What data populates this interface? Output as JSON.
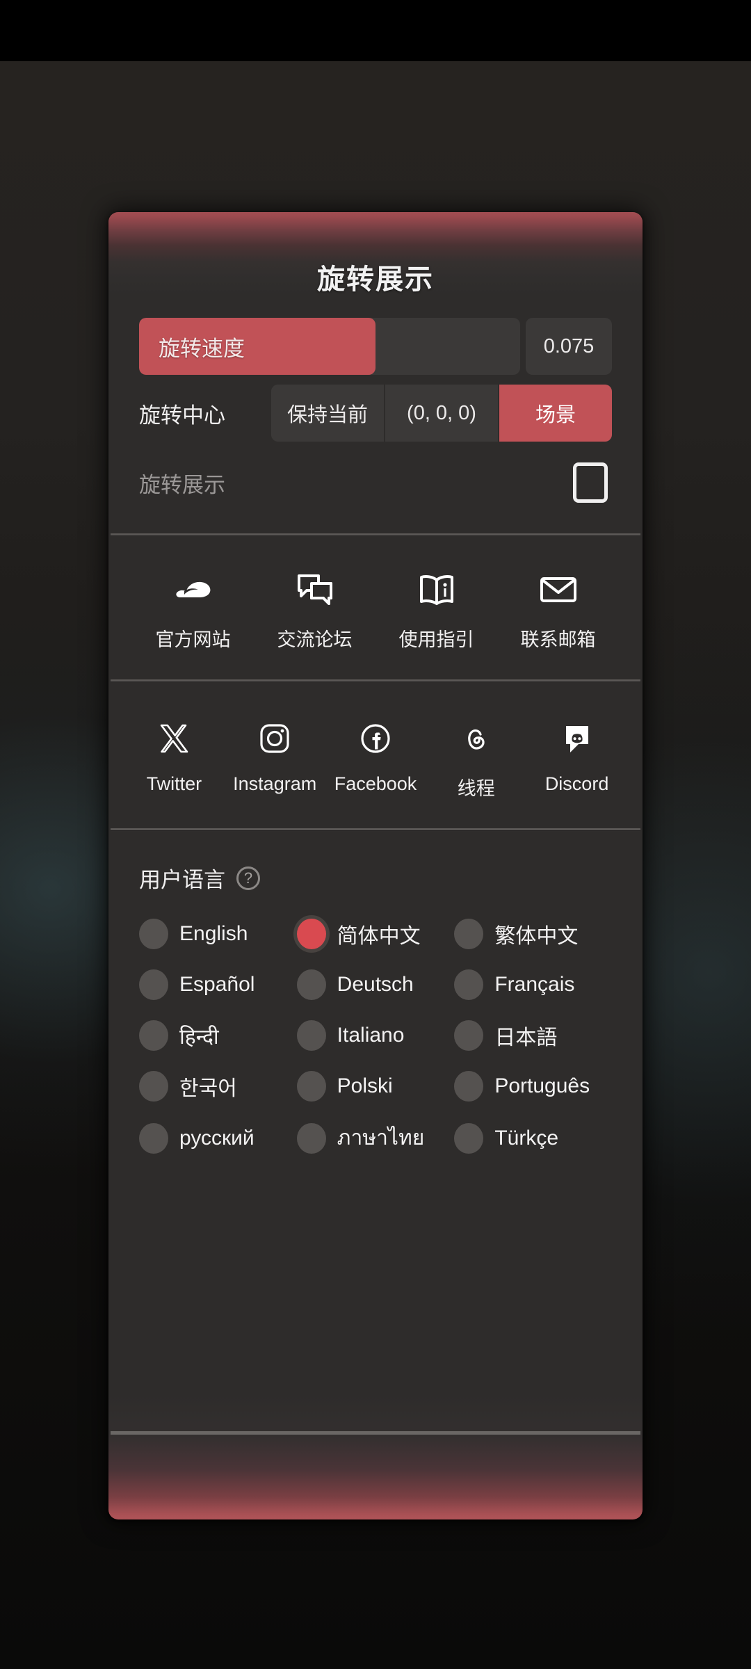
{
  "panel": {
    "title": "旋转展示"
  },
  "rotation": {
    "speed": {
      "label": "旋转速度",
      "value": "0.075",
      "fill_percent": 62
    },
    "center": {
      "label": "旋转中心",
      "options": [
        {
          "label": "保持当前",
          "active": false
        },
        {
          "label": "(0, 0, 0)",
          "active": false
        },
        {
          "label": "场景",
          "active": true
        }
      ]
    },
    "showcase": {
      "label": "旋转展示",
      "checked": false
    }
  },
  "links": [
    {
      "label": "官方网站",
      "icon": "cloud-icon"
    },
    {
      "label": "交流论坛",
      "icon": "forum-icon"
    },
    {
      "label": "使用指引",
      "icon": "book-info-icon"
    },
    {
      "label": "联系邮箱",
      "icon": "envelope-icon"
    }
  ],
  "socials": [
    {
      "label": "Twitter",
      "icon": "twitter-x-icon"
    },
    {
      "label": "Instagram",
      "icon": "instagram-icon"
    },
    {
      "label": "Facebook",
      "icon": "facebook-icon"
    },
    {
      "label": "线程",
      "icon": "threads-icon"
    },
    {
      "label": "Discord",
      "icon": "discord-icon"
    }
  ],
  "language": {
    "title": "用户语言",
    "help": "?",
    "rows": [
      [
        {
          "label": "English",
          "selected": false
        },
        {
          "label": "简体中文",
          "selected": true
        },
        {
          "label": "繁体中文",
          "selected": false
        }
      ],
      [
        {
          "label": "Español",
          "selected": false
        },
        {
          "label": "Deutsch",
          "selected": false
        },
        {
          "label": "Français",
          "selected": false
        }
      ],
      [
        {
          "label": "हिन्दी",
          "selected": false
        },
        {
          "label": "Italiano",
          "selected": false
        },
        {
          "label": "日本語",
          "selected": false
        }
      ],
      [
        {
          "label": "한국어",
          "selected": false
        },
        {
          "label": "Polski",
          "selected": false
        },
        {
          "label": "Português",
          "selected": false
        }
      ],
      [
        {
          "label": "русский",
          "selected": false
        },
        {
          "label": "ภาษาไทย",
          "selected": false
        },
        {
          "label": "Türkçe",
          "selected": false
        }
      ]
    ]
  },
  "colors": {
    "accent": "#c15257",
    "accent_radio": "#d94a50",
    "panel_bg": "#2e2c2b",
    "control_bg": "#3b3938",
    "text": "#f1f0f0",
    "muted_text": "#9b9897"
  }
}
